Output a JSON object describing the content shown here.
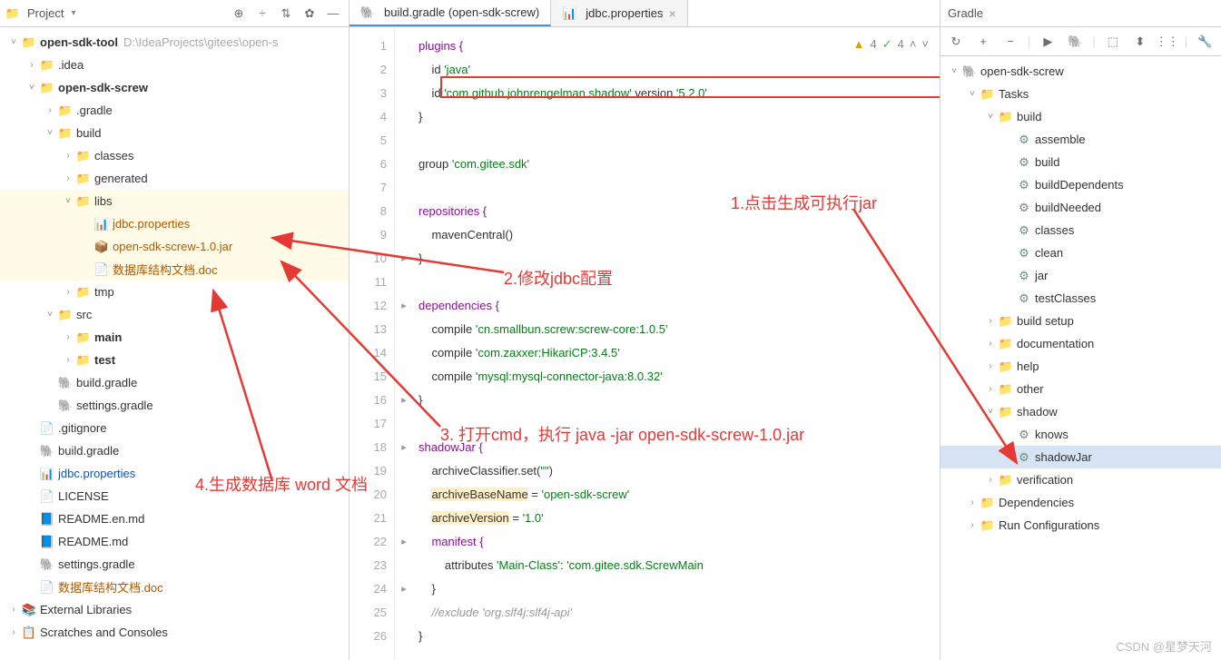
{
  "project_panel": {
    "title": "Project",
    "root": {
      "label": "open-sdk-tool",
      "path": "D:\\IdeaProjects\\gitees\\open-s"
    },
    "items": {
      "idea": ".idea",
      "screw": "open-sdk-screw",
      "gradle_dir": ".gradle",
      "build": "build",
      "classes": "classes",
      "generated": "generated",
      "libs": "libs",
      "jdbc_props": "jdbc.properties",
      "jar": "open-sdk-screw-1.0.jar",
      "doc1": "数据库结构文档.doc",
      "tmp": "tmp",
      "src": "src",
      "main": "main",
      "test": "test",
      "build_gradle": "build.gradle",
      "settings_gradle": "settings.gradle",
      "gitignore": ".gitignore",
      "build_gradle2": "build.gradle",
      "jdbc_props2": "jdbc.properties",
      "license": "LICENSE",
      "readme_en": "README.en.md",
      "readme": "README.md",
      "settings_gradle2": "settings.gradle",
      "doc2": "数据库结构文档.doc",
      "ext_libs": "External Libraries",
      "scratches": "Scratches and Consoles"
    }
  },
  "tabs": {
    "t1": "build.gradle (open-sdk-screw)",
    "t2": "jdbc.properties"
  },
  "inspect": {
    "warn": "4",
    "ok": "4"
  },
  "code": {
    "l1": "plugins {",
    "l2a": "    id ",
    "l2b": "'java'",
    "l3a": "    id ",
    "l3b": "'com.github.johnrengelman.shadow'",
    "l3c": " version ",
    "l3d": "'5.2.0'",
    "l4": "}",
    "l5": "",
    "l6a": "group ",
    "l6b": "'com.gitee.sdk'",
    "l7": "",
    "l8": "repositories {",
    "l9": "    mavenCentral()",
    "l10": "}",
    "l11": "",
    "l12": "dependencies {",
    "l13a": "    compile ",
    "l13b": "'cn.smallbun.screw:screw-core:1.0.5'",
    "l14a": "    compile ",
    "l14b": "'com.zaxxer:HikariCP:3.4.5'",
    "l15a": "    compile ",
    "l15b": "'mysql:mysql-connector-java:8.0.32'",
    "l16": "}",
    "l17": "",
    "l18": "shadowJar {",
    "l19a": "    archiveClassifier.set(",
    "l19b": "\"\"",
    "l19c": ")",
    "l20a": "    ",
    "l20b": "archiveBaseName",
    "l20c": " = ",
    "l20d": "'open-sdk-screw'",
    "l21a": "    ",
    "l21b": "archiveVersion",
    "l21c": " = ",
    "l21d": "'1.0'",
    "l22": "    manifest {",
    "l23a": "        attributes ",
    "l23b": "'Main-Class'",
    "l23c": ": ",
    "l23d": "'com.gitee.sdk.ScrewMain",
    "l24": "    }",
    "l25a": "    ",
    "l25b": "//exclude 'org.slf4j:slf4j-api'",
    "l26": "}"
  },
  "annotations": {
    "a1": "1.点击生成可执行jar",
    "a2": "2.修改jdbc配置",
    "a3": "3. 打开cmd，执行 java -jar open-sdk-screw-1.0.jar",
    "a4": "4.生成数据库 word 文档"
  },
  "gradle_panel": {
    "title": "Gradle",
    "root": "open-sdk-screw",
    "tasks": "Tasks",
    "build_folder": "build",
    "tasks_list": [
      "assemble",
      "build",
      "buildDependents",
      "buildNeeded",
      "classes",
      "clean",
      "jar",
      "testClasses"
    ],
    "folders": [
      "build setup",
      "documentation",
      "help",
      "other"
    ],
    "shadow": "shadow",
    "knows": "knows",
    "shadowJar": "shadowJar",
    "verification": "verification",
    "deps": "Dependencies",
    "run_configs": "Run Configurations"
  },
  "footer": "CSDN @星梦天河"
}
